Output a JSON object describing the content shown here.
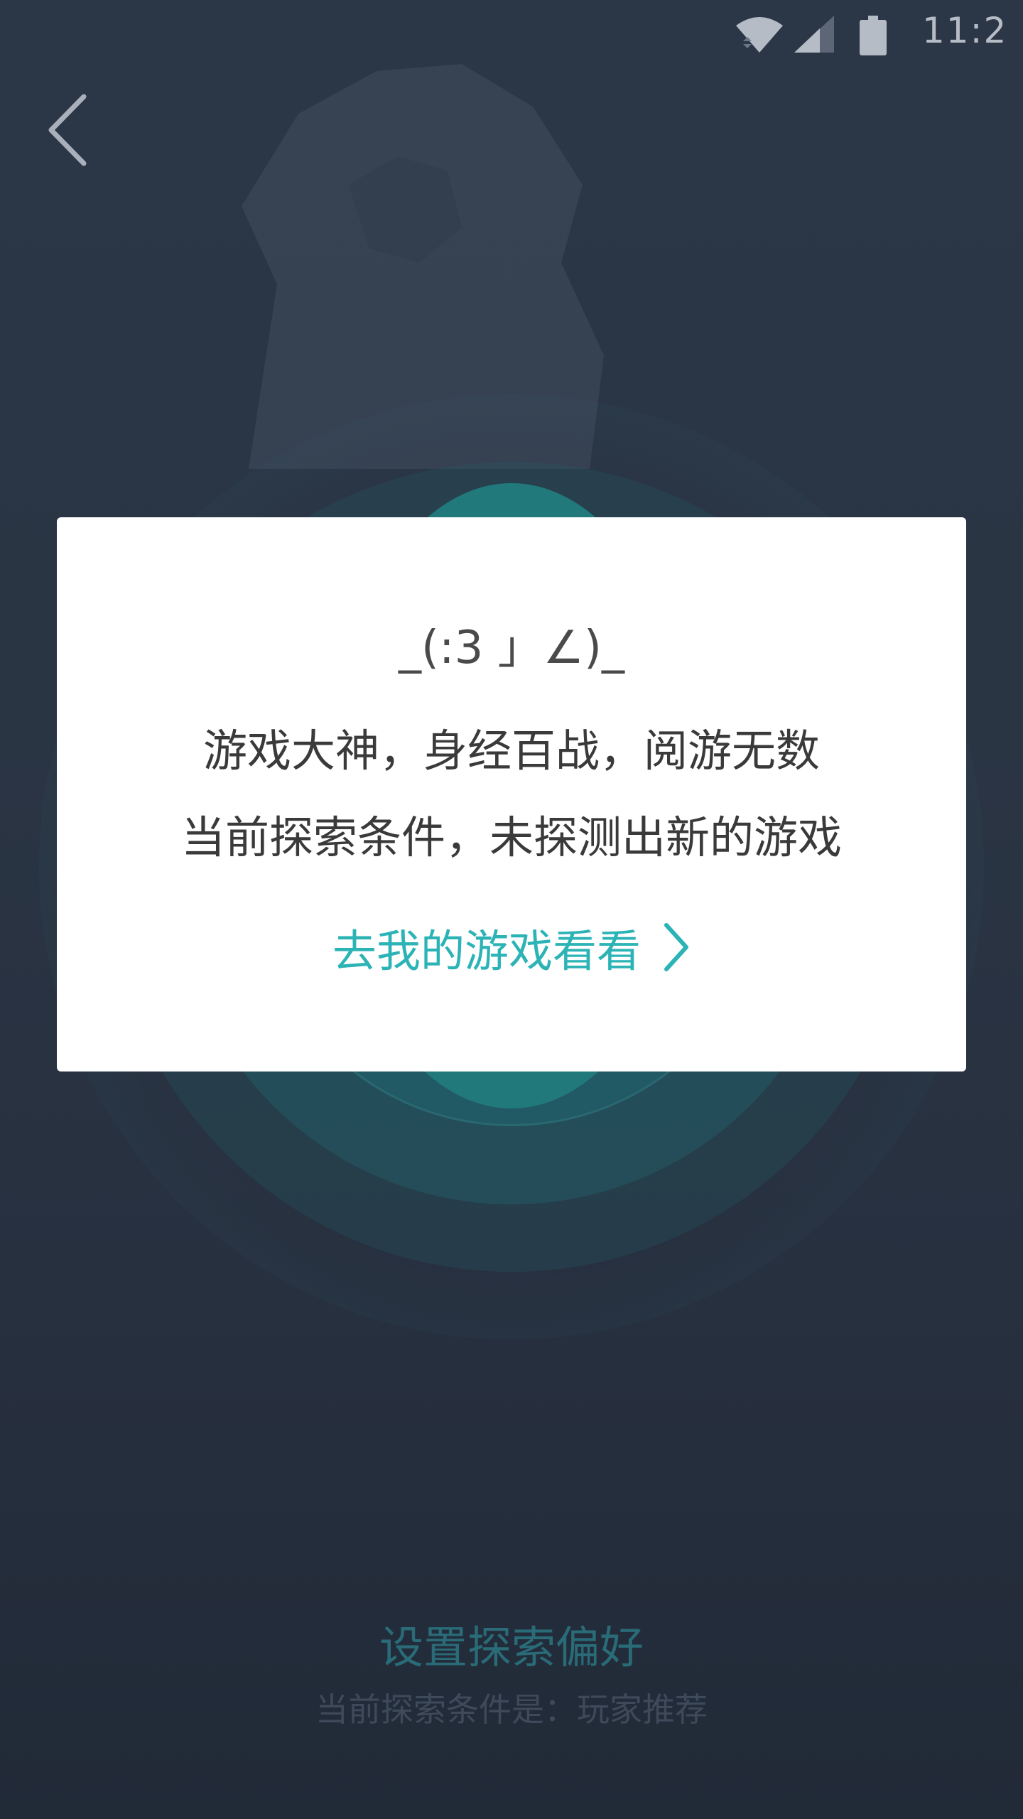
{
  "status_bar": {
    "time": "11:2",
    "icons": [
      "wifi-icon",
      "cell-signal-icon",
      "battery-icon"
    ]
  },
  "navigation": {
    "back_icon": "chevron-left-icon"
  },
  "dialog": {
    "emoticon": "_(:3 」∠)_",
    "line1": "游戏大神，身经百战，阅游无数",
    "line2": "当前探索条件，未探测出新的游戏",
    "link_label": "去我的游戏看看",
    "link_icon": "chevron-right-icon",
    "link_color": "#2bb3b6"
  },
  "preferences": {
    "title": "设置探索偏好",
    "subtitle": "当前探索条件是：玩家推荐"
  },
  "colors": {
    "background": "#2a3544",
    "accent": "#2bb3b6",
    "radar": "#21797b"
  }
}
